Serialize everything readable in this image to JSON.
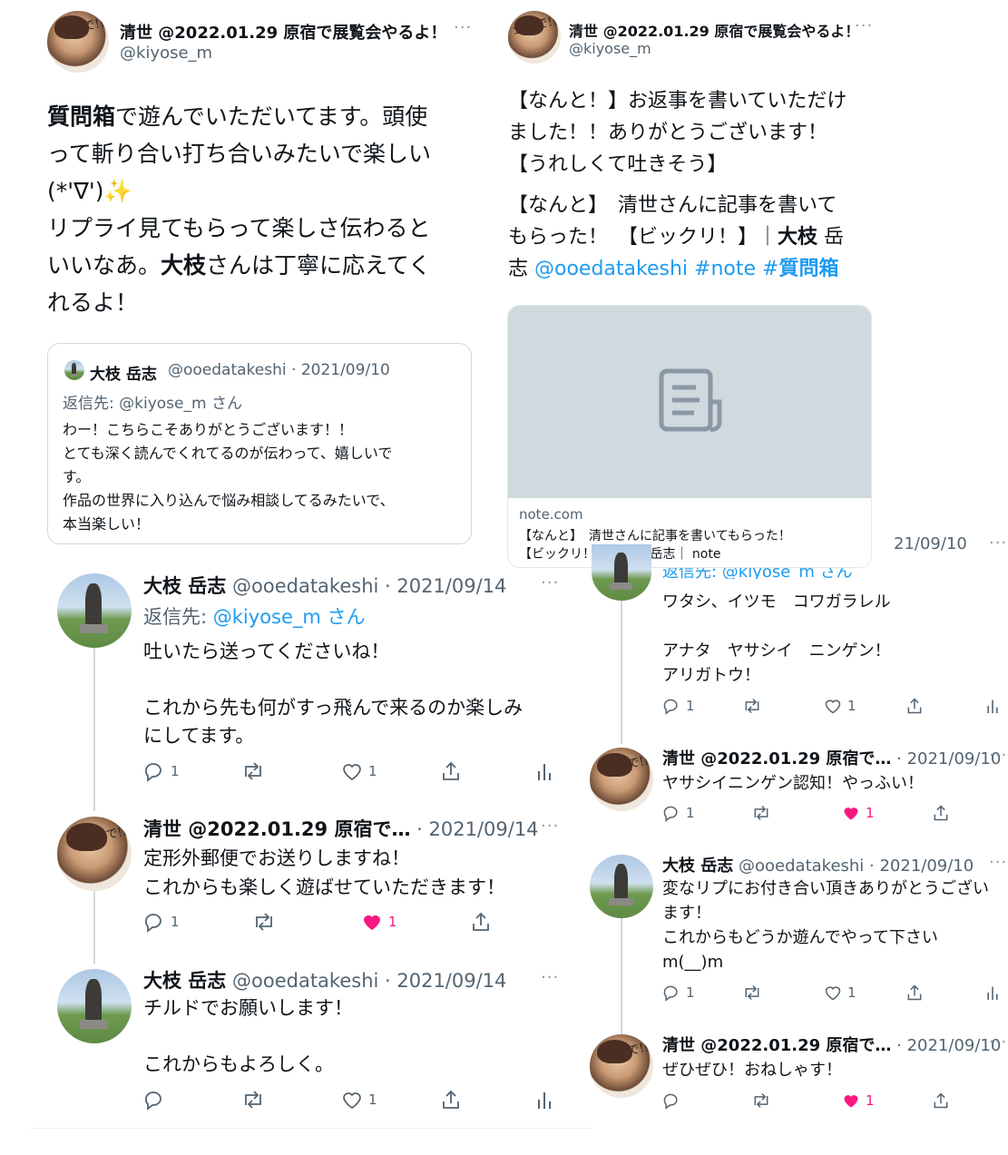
{
  "left_main": {
    "name": "清世 @2022.01.29 原宿で展覧会やるよ！",
    "handle": "@kiyose_m",
    "text_lines": [
      [
        "質問箱",
        "で遊んでいただいてます。頭使"
      ],
      "って斬り合い打ち合いみたいで楽しい",
      "(*'∇')✨",
      "リプライ見てもらって楽しさ伝わると",
      [
        "いいなあ。",
        "大枝",
        "さんは丁寧に応えてく"
      ],
      "れるよ！"
    ],
    "quote": {
      "name": "大枝 岳志",
      "handle_date": "@ooedatakeshi · 2021/09/10",
      "reply_to": "返信先: @kiyose_m さん",
      "lines": [
        "わー！こちらこそありがとうございます！！",
        "とても深く読んでくれてるのが伝わって、嬉しいで",
        "す。",
        "作品の世界に入り込んで悩み相談してるみたいで、",
        "本当楽しい！"
      ]
    }
  },
  "right_main": {
    "name": "清世 @2022.01.29 原宿で展覧会やるよ！",
    "handle": "@kiyose_m",
    "lines": [
      "【なんと！】お返事を書いていただけ",
      "ました！！ありがとうございます！",
      "【うれしくて吐きそう】"
    ],
    "line4": "【なんと】　清世さんに記事を書いて",
    "line5a": "もらった！　【ビックリ！】｜",
    "line5b": "大枝",
    "line5c": " 岳",
    "line6a": "志 ",
    "link1": "@ooedatakeshi",
    "link2": " #note ",
    "link3a": "#",
    "link3b": "質問箱",
    "card": {
      "domain": "note.com",
      "title1": "【なんと】　清世さんに記事を書いてもらった！",
      "title2": "【ビックリ！】｜大枝 岳志｜ note"
    }
  },
  "left_thread": [
    {
      "name": "大枝 岳志",
      "handle_date": "@ooedatakeshi · 2021/09/14",
      "reply_prefix": "返信先: ",
      "reply_handle": "@kiyose_m",
      "reply_suffix": " さん",
      "lines": [
        "吐いたら送ってくださいね！",
        "",
        "これから先も何がすっ飛んで来るのか楽しみ",
        "にしてます。"
      ],
      "reply": "1",
      "like": "1",
      "liked": false
    },
    {
      "name": "清世 @2022.01.29 原宿で…",
      "handle_date": " · 2021/09/14",
      "lines": [
        "定形外郵便でお送りしますね！",
        "これからも楽しく遊ばせていただきます！"
      ],
      "reply": "1",
      "like": "1",
      "liked": true
    },
    {
      "name": "大枝 岳志",
      "handle_date": "@ooedatakeshi · 2021/09/14",
      "lines": [
        "チルドでお願いします！",
        "",
        "これからもよろしく。"
      ],
      "reply": "",
      "like": "1",
      "liked": false
    }
  ],
  "right_thread": {
    "partial_date": "21/09/10",
    "partial_reply": "返信先: @kiyose_m さん",
    "first_lines": [
      "ワタシ、イツモ　コワガラレル",
      "",
      "アナタ　ヤサシイ　ニンゲン！",
      "アリガトウ！"
    ],
    "first_reply": "1",
    "first_like": "1",
    "items": [
      {
        "name": "清世 @2022.01.29 原宿で…",
        "handle_date": " · 2021/09/10",
        "lines": [
          "ヤサシイニンゲン認知！やっふい！"
        ],
        "reply": "1",
        "like": "1",
        "liked": true
      },
      {
        "name": "大枝 岳志",
        "handle_date": "@ooedatakeshi · 2021/09/10",
        "lines": [
          "変なリプにお付き合い頂きありがとうござい",
          "ます！",
          "これからもどうか遊んでやって下さい",
          "m(__)m"
        ],
        "reply": "1",
        "like": "1",
        "liked": false
      },
      {
        "name": "清世 @2022.01.29 原宿で…",
        "handle_date": " · 2021/09/10",
        "lines": [
          "ぜひぜひ！おねしゃす！"
        ],
        "reply": "",
        "like": "1",
        "liked": true
      }
    ]
  },
  "avatar_text": "全力で!!",
  "colors": {
    "link": "#1d9bf0",
    "like": "#f91880",
    "gray": "#536471"
  },
  "icons": [
    "reply-icon",
    "retweet-icon",
    "like-icon",
    "share-icon",
    "analytics-icon",
    "more-icon",
    "document-icon"
  ]
}
